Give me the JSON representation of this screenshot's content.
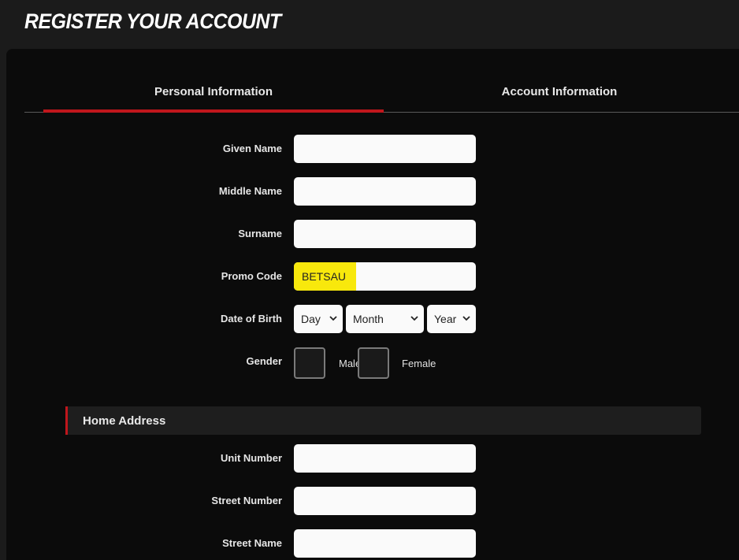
{
  "page": {
    "title": "REGISTER YOUR ACCOUNT"
  },
  "tabs": [
    {
      "label": "Personal Information",
      "active": true
    },
    {
      "label": "Account Information",
      "active": false
    }
  ],
  "accent_color": "#c0161c",
  "promo_highlight_color": "#f8e80c",
  "fields": {
    "given_name": {
      "label": "Given Name",
      "value": ""
    },
    "middle_name": {
      "label": "Middle Name",
      "value": ""
    },
    "surname": {
      "label": "Surname",
      "value": ""
    },
    "promo_code": {
      "label": "Promo Code",
      "value": "BETSAU"
    },
    "date_of_birth": {
      "label": "Date of Birth",
      "day": "Day",
      "month": "Month",
      "year": "Year"
    },
    "gender": {
      "label": "Gender",
      "options": [
        "Male",
        "Female"
      ]
    }
  },
  "home_address": {
    "heading": "Home Address",
    "unit_number": {
      "label": "Unit Number",
      "value": ""
    },
    "street_number": {
      "label": "Street Number",
      "value": ""
    },
    "street_name": {
      "label": "Street Name",
      "value": ""
    }
  },
  "icons": {
    "select_arrow": "chevron-down-icon"
  }
}
